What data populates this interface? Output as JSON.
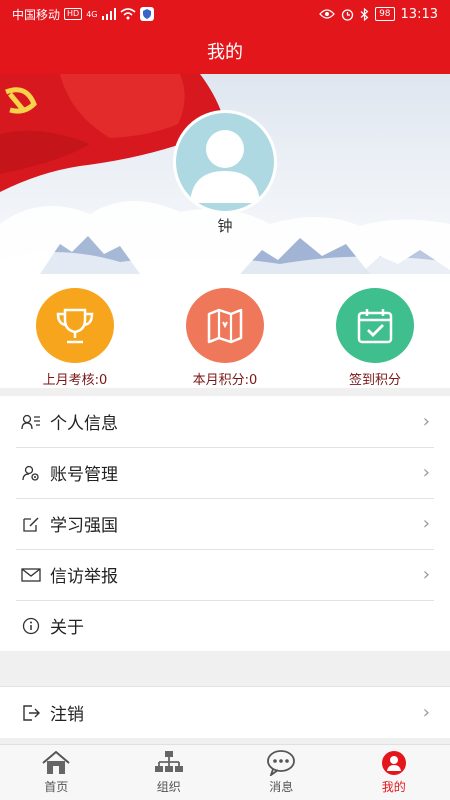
{
  "status_bar": {
    "carrier": "中国移动",
    "hd": "HD",
    "network": "4G",
    "battery": "98",
    "time": "13:13"
  },
  "header": {
    "title": "我的"
  },
  "profile": {
    "name": "钟"
  },
  "stats": [
    {
      "label": "上月考核:0",
      "icon": "trophy-icon",
      "color": "#f7a51c"
    },
    {
      "label": "本月积分:0",
      "icon": "map-icon",
      "color": "#f0785a"
    },
    {
      "label": "签到积分",
      "icon": "calendar-check-icon",
      "color": "#3fbf8d"
    }
  ],
  "menu": [
    {
      "label": "个人信息",
      "icon": "user-card-icon"
    },
    {
      "label": "账号管理",
      "icon": "user-gear-icon"
    },
    {
      "label": "学习强国",
      "icon": "edit-icon"
    },
    {
      "label": "信访举报",
      "icon": "mail-icon"
    },
    {
      "label": "关于",
      "icon": "info-icon"
    }
  ],
  "logout": {
    "label": "注销",
    "icon": "logout-icon"
  },
  "bottom_nav": [
    {
      "label": "首页",
      "icon": "home-icon"
    },
    {
      "label": "组织",
      "icon": "org-chart-icon"
    },
    {
      "label": "消息",
      "icon": "chat-icon"
    },
    {
      "label": "我的",
      "icon": "user-icon",
      "active": true
    }
  ],
  "colors": {
    "primary": "#e3161c",
    "stat_label": "#7a1616"
  }
}
